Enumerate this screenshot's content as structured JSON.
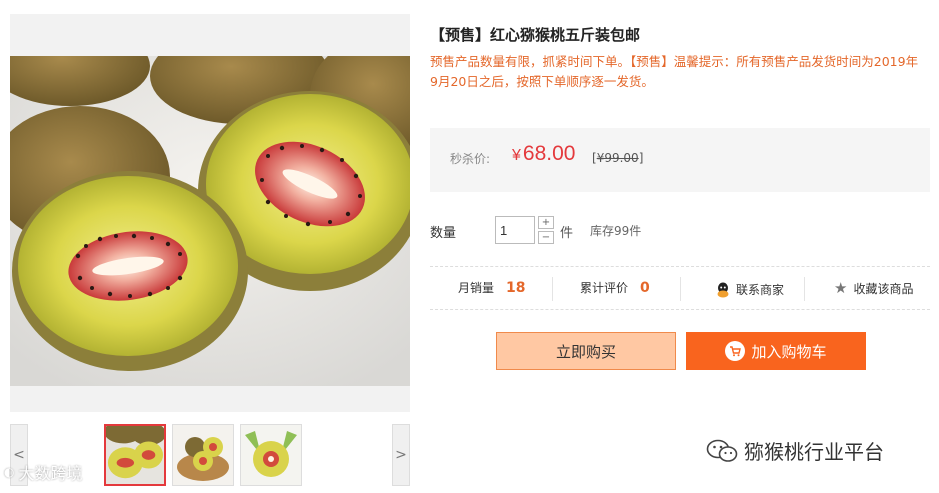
{
  "product": {
    "title": "【预售】红心猕猴桃五斤装包邮",
    "notice": "预售产品数量有限，抓紧时间下单。【预售】温馨提示：所有预售产品发货时间为2019年9月20日之后，按照下单顺序逐一发货。"
  },
  "price": {
    "label": "秒杀价:",
    "currency": "¥",
    "current": "68.00",
    "original": "¥99.00",
    "accent_color": "#e4393c"
  },
  "quantity": {
    "label": "数量",
    "value": "1",
    "plus": "+",
    "minus": "−",
    "unit": "件",
    "stock": "库存99件"
  },
  "stats": {
    "sales_label": "月销量",
    "sales_value": "18",
    "reviews_label": "累计评价",
    "reviews_value": "0",
    "contact_label": "联系商家",
    "favorite_label": "收藏该商品"
  },
  "buttons": {
    "buy_now": "立即购买",
    "add_to_cart": "加入购物车",
    "cart_color": "#f9641e"
  },
  "gallery": {
    "prev": "<",
    "next": ">"
  },
  "watermarks": {
    "left": "大数跨境",
    "right": "猕猴桃行业平台"
  }
}
